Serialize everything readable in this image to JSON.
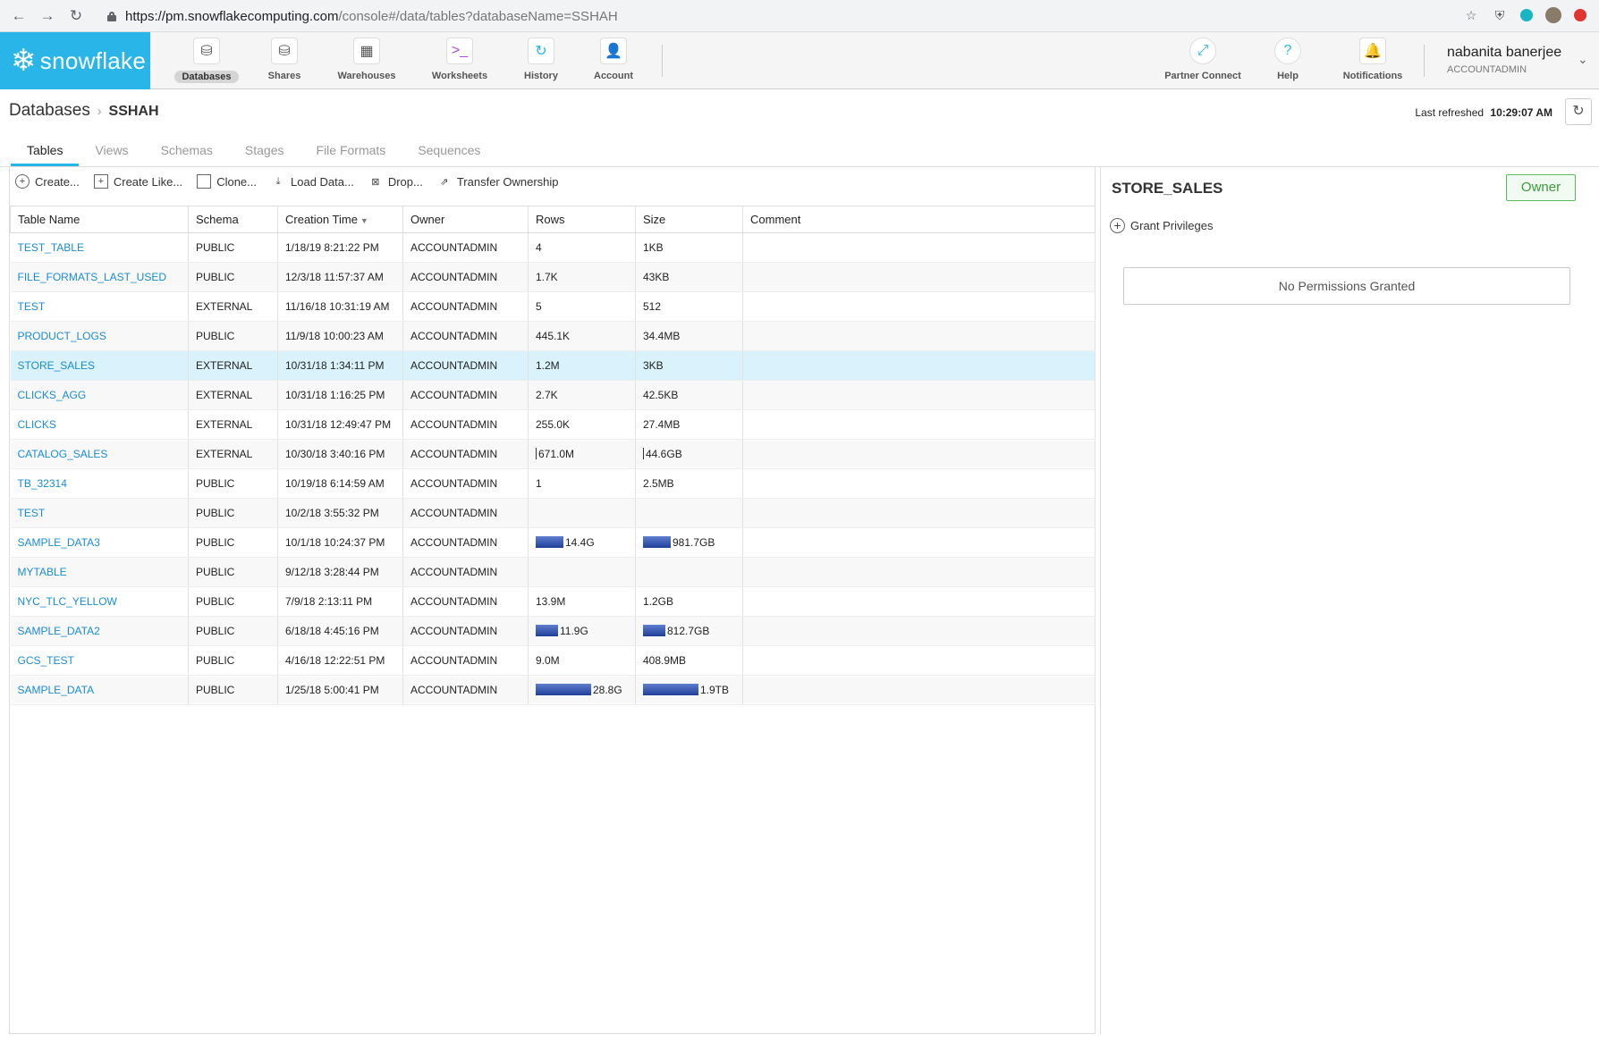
{
  "browser": {
    "url_host": "https://pm.snowflakecomputing.com",
    "url_path": "/console#/data/tables?databaseName=SSHAH"
  },
  "brand": {
    "logo_text": "snowflake",
    "accent": "#29b5e8"
  },
  "nav": [
    {
      "label": "Databases",
      "icon": "database-icon",
      "active": true
    },
    {
      "label": "Shares",
      "icon": "shares-icon"
    },
    {
      "label": "Warehouses",
      "icon": "warehouse-icon"
    },
    {
      "label": "Worksheets",
      "icon": "worksheet-icon"
    },
    {
      "label": "History",
      "icon": "history-icon"
    },
    {
      "label": "Account",
      "icon": "account-icon"
    }
  ],
  "nav_right": [
    {
      "label": "Partner Connect",
      "icon": "partner-connect-icon"
    },
    {
      "label": "Help",
      "icon": "help-icon"
    },
    {
      "label": "Notifications",
      "icon": "bell-icon"
    }
  ],
  "user": {
    "name": "nabanita banerjee",
    "role": "ACCOUNTADMIN"
  },
  "breadcrumb": {
    "root": "Databases",
    "current": "SSHAH"
  },
  "refresh": {
    "label": "Last refreshed",
    "time": "10:29:07 AM"
  },
  "tabs": [
    "Tables",
    "Views",
    "Schemas",
    "Stages",
    "File Formats",
    "Sequences"
  ],
  "toolbar": {
    "create": "Create...",
    "create_like": "Create Like...",
    "clone": "Clone...",
    "load_data": "Load Data...",
    "drop": "Drop...",
    "transfer": "Transfer Ownership"
  },
  "table": {
    "columns": [
      "Table Name",
      "Schema",
      "Creation Time",
      "Owner",
      "Rows",
      "Size",
      "Comment"
    ],
    "rows": [
      {
        "name": "TEST_TABLE",
        "schema": "PUBLIC",
        "created": "1/18/19 8:21:22 PM",
        "owner": "ACCOUNTADMIN",
        "rows": "4",
        "size": "1KB",
        "rows_bar": 0,
        "size_bar": 0
      },
      {
        "name": "FILE_FORMATS_LAST_USED",
        "schema": "PUBLIC",
        "created": "12/3/18 11:57:37 AM",
        "owner": "ACCOUNTADMIN",
        "rows": "1.7K",
        "size": "43KB",
        "rows_bar": 0,
        "size_bar": 0
      },
      {
        "name": "TEST",
        "schema": "EXTERNAL",
        "created": "11/16/18 10:31:19 AM",
        "owner": "ACCOUNTADMIN",
        "rows": "5",
        "size": "512",
        "rows_bar": 0,
        "size_bar": 0
      },
      {
        "name": "PRODUCT_LOGS",
        "schema": "PUBLIC",
        "created": "11/9/18 10:00:23 AM",
        "owner": "ACCOUNTADMIN",
        "rows": "445.1K",
        "size": "34.4MB",
        "rows_bar": 0,
        "size_bar": 0
      },
      {
        "name": "STORE_SALES",
        "schema": "EXTERNAL",
        "created": "10/31/18 1:34:11 PM",
        "owner": "ACCOUNTADMIN",
        "rows": "1.2M",
        "size": "3KB",
        "rows_bar": 0,
        "size_bar": 0,
        "selected": true
      },
      {
        "name": "CLICKS_AGG",
        "schema": "EXTERNAL",
        "created": "10/31/18 1:16:25 PM",
        "owner": "ACCOUNTADMIN",
        "rows": "2.7K",
        "size": "42.5KB",
        "rows_bar": 0,
        "size_bar": 0
      },
      {
        "name": "CLICKS",
        "schema": "EXTERNAL",
        "created": "10/31/18 12:49:47 PM",
        "owner": "ACCOUNTADMIN",
        "rows": "255.0K",
        "size": "27.4MB",
        "rows_bar": 0,
        "size_bar": 0
      },
      {
        "name": "CATALOG_SALES",
        "schema": "EXTERNAL",
        "created": "10/30/18 3:40:16 PM",
        "owner": "ACCOUNTADMIN",
        "rows": "671.0M",
        "size": "44.6GB",
        "rows_bar": 0.02,
        "size_bar": 0.02
      },
      {
        "name": "TB_32314",
        "schema": "PUBLIC",
        "created": "10/19/18 6:14:59 AM",
        "owner": "ACCOUNTADMIN",
        "rows": "1",
        "size": "2.5MB",
        "rows_bar": 0,
        "size_bar": 0
      },
      {
        "name": "TEST",
        "schema": "PUBLIC",
        "created": "10/2/18 3:55:32 PM",
        "owner": "ACCOUNTADMIN",
        "rows": "",
        "size": "",
        "rows_bar": 0,
        "size_bar": 0
      },
      {
        "name": "SAMPLE_DATA3",
        "schema": "PUBLIC",
        "created": "10/1/18 10:24:37 PM",
        "owner": "ACCOUNTADMIN",
        "rows": "14.4G",
        "size": "981.7GB",
        "rows_bar": 0.5,
        "size_bar": 0.5
      },
      {
        "name": "MYTABLE",
        "schema": "PUBLIC",
        "created": "9/12/18 3:28:44 PM",
        "owner": "ACCOUNTADMIN",
        "rows": "",
        "size": "",
        "rows_bar": 0,
        "size_bar": 0
      },
      {
        "name": "NYC_TLC_YELLOW",
        "schema": "PUBLIC",
        "created": "7/9/18 2:13:11 PM",
        "owner": "ACCOUNTADMIN",
        "rows": "13.9M",
        "size": "1.2GB",
        "rows_bar": 0,
        "size_bar": 0
      },
      {
        "name": "SAMPLE_DATA2",
        "schema": "PUBLIC",
        "created": "6/18/18 4:45:16 PM",
        "owner": "ACCOUNTADMIN",
        "rows": "11.9G",
        "size": "812.7GB",
        "rows_bar": 0.41,
        "size_bar": 0.41
      },
      {
        "name": "GCS_TEST",
        "schema": "PUBLIC",
        "created": "4/16/18 12:22:51 PM",
        "owner": "ACCOUNTADMIN",
        "rows": "9.0M",
        "size": "408.9MB",
        "rows_bar": 0,
        "size_bar": 0
      },
      {
        "name": "SAMPLE_DATA",
        "schema": "PUBLIC",
        "created": "1/25/18 5:00:41 PM",
        "owner": "ACCOUNTADMIN",
        "rows": "28.8G",
        "size": "1.9TB",
        "rows_bar": 1,
        "size_bar": 1
      }
    ]
  },
  "detail": {
    "title": "STORE_SALES",
    "owner_label": "Owner",
    "grant_label": "Grant Privileges",
    "empty_text": "No Permissions Granted"
  }
}
